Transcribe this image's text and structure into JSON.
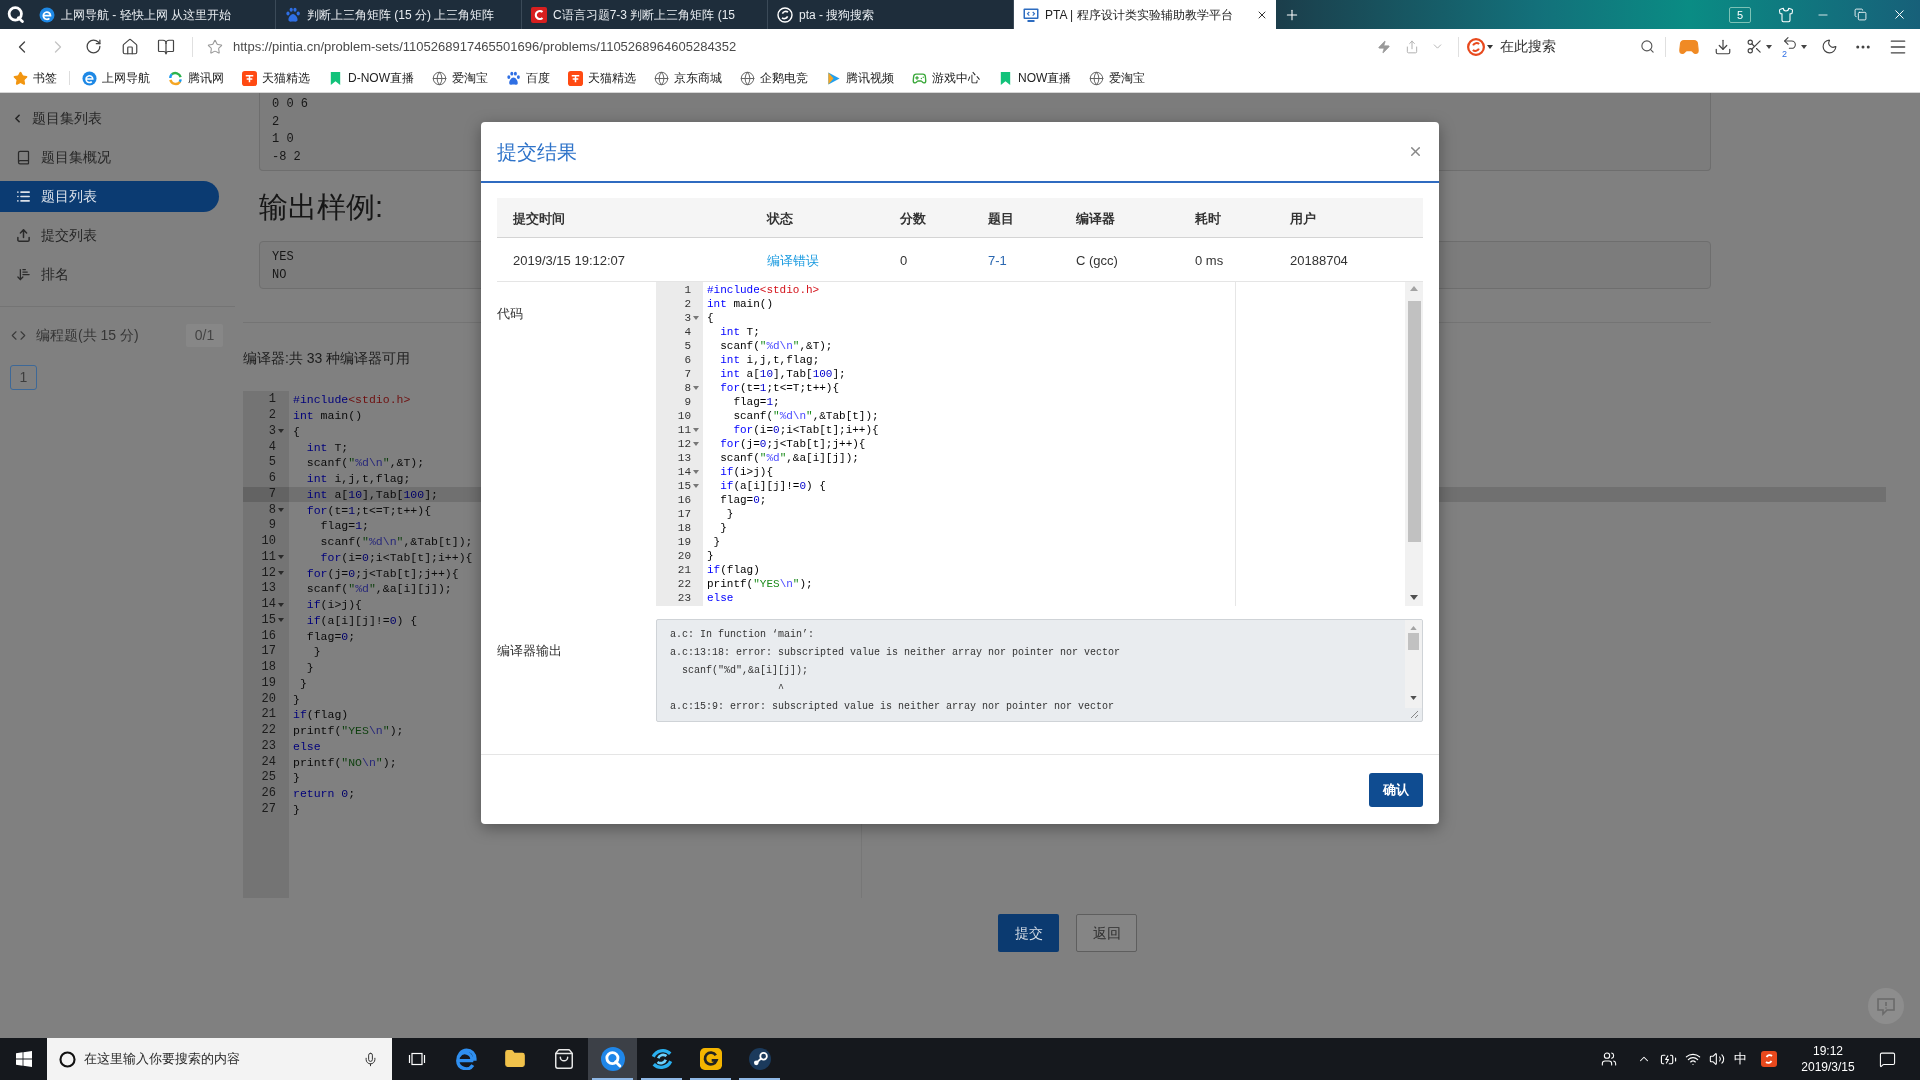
{
  "browser": {
    "tabs": [
      {
        "title": "上网导航 - 轻快上网 从这里开始",
        "kind": "e",
        "selected": false
      },
      {
        "title": "判断上三角矩阵 (15 分) 上三角矩阵",
        "kind": "paw",
        "selected": false
      },
      {
        "title": "C语言习题7-3 判断上三角矩阵 (15",
        "kind": "c",
        "selected": false
      },
      {
        "title": "pta - 搜狗搜索",
        "kind": "s",
        "selected": false
      },
      {
        "title": "PTA | 程序设计类实验辅助教学平台",
        "kind": "pta",
        "selected": true
      }
    ],
    "tab_count": "5",
    "back": {
      "disabled": false
    },
    "forward": {
      "disabled": true
    },
    "address": "https://pintia.cn/problem-sets/1105268917465501696/problems/1105268964605284352",
    "search": {
      "placeholder": "在此搜索"
    },
    "undo_count": "2",
    "bookmarks": [
      {
        "label": "书签",
        "kind": "star"
      },
      {
        "label": "上网导航",
        "kind": "e"
      },
      {
        "label": "腾讯网",
        "kind": "tencent"
      },
      {
        "label": "天猫精选",
        "kind": "tmall"
      },
      {
        "label": "D-NOW直播",
        "kind": "now"
      },
      {
        "label": "爱淘宝",
        "kind": "globe"
      },
      {
        "label": "百度",
        "kind": "paw"
      },
      {
        "label": "天猫精选",
        "kind": "tmall"
      },
      {
        "label": "京东商城",
        "kind": "globe"
      },
      {
        "label": "企鹅电竞",
        "kind": "globe"
      },
      {
        "label": "腾讯视频",
        "kind": "play"
      },
      {
        "label": "游戏中心",
        "kind": "gamepad"
      },
      {
        "label": "NOW直播",
        "kind": "now"
      },
      {
        "label": "爱淘宝",
        "kind": "globe"
      }
    ]
  },
  "sidebar": {
    "back": "题目集列表",
    "items": [
      {
        "label": "题目集概况",
        "kind": "book",
        "selected": false
      },
      {
        "label": "题目列表",
        "kind": "list",
        "selected": true
      },
      {
        "label": "提交列表",
        "kind": "upload",
        "selected": false
      },
      {
        "label": "排名",
        "kind": "rank",
        "selected": false
      }
    ],
    "section": {
      "title": "编程题(共 15 分)",
      "score": "0/1",
      "problems": [
        {
          "label": "1",
          "selected": true
        }
      ]
    }
  },
  "page": {
    "input_sample": [
      "0 0 6",
      "2",
      "1 0",
      "-8 2"
    ],
    "output_heading": "输出样例:",
    "output_sample": [
      "YES",
      "NO"
    ],
    "compiler_note": "编译器:共 33 种编译器可用",
    "editor": {
      "lines": [
        {
          "no": "1",
          "fold": false,
          "highlighted": false,
          "code": [
            {
              "kind": "keyword",
              "text": "#include"
            },
            {
              "kind": "header",
              "text": "<stdio.h>"
            }
          ]
        },
        {
          "no": "2",
          "fold": false,
          "highlighted": false,
          "code": [
            {
              "kind": "keyword",
              "text": "int"
            },
            {
              "kind": "text",
              "text": " main()"
            }
          ]
        },
        {
          "no": "3",
          "fold": true,
          "highlighted": false,
          "code": [
            {
              "kind": "text",
              "text": "{"
            }
          ]
        },
        {
          "no": "4",
          "fold": false,
          "highlighted": false,
          "code": [
            {
              "kind": "keyword",
              "text": "  int"
            },
            {
              "kind": "text",
              "text": " T;"
            }
          ]
        },
        {
          "no": "5",
          "fold": false,
          "highlighted": false,
          "code": [
            {
              "kind": "text",
              "text": "  scanf("
            },
            {
              "kind": "string",
              "text": "\""
            },
            {
              "kind": "escape",
              "text": "%d\\n"
            },
            {
              "kind": "string",
              "text": "\""
            },
            {
              "kind": "text",
              "text": ",&T);"
            }
          ]
        },
        {
          "no": "6",
          "fold": false,
          "highlighted": false,
          "code": [
            {
              "kind": "keyword",
              "text": "  int"
            },
            {
              "kind": "text",
              "text": " i,j,t,flag;"
            }
          ]
        },
        {
          "no": "7",
          "fold": false,
          "highlighted": true,
          "code": [
            {
              "kind": "keyword",
              "text": "  int"
            },
            {
              "kind": "text",
              "text": " a["
            },
            {
              "kind": "number",
              "text": "10"
            },
            {
              "kind": "text",
              "text": "],Tab["
            },
            {
              "kind": "number",
              "text": "100"
            },
            {
              "kind": "text",
              "text": "];"
            }
          ]
        },
        {
          "no": "8",
          "fold": true,
          "highlighted": false,
          "code": [
            {
              "kind": "keyword",
              "text": "  for"
            },
            {
              "kind": "text",
              "text": "(t="
            },
            {
              "kind": "number",
              "text": "1"
            },
            {
              "kind": "text",
              "text": ";t<=T;t++){"
            }
          ]
        },
        {
          "no": "9",
          "fold": false,
          "highlighted": false,
          "code": [
            {
              "kind": "text",
              "text": "    flag="
            },
            {
              "kind": "number",
              "text": "1"
            },
            {
              "kind": "text",
              "text": ";"
            }
          ]
        },
        {
          "no": "10",
          "fold": false,
          "highlighted": false,
          "code": [
            {
              "kind": "text",
              "text": "    scanf("
            },
            {
              "kind": "string",
              "text": "\""
            },
            {
              "kind": "escape",
              "text": "%d\\n"
            },
            {
              "kind": "string",
              "text": "\""
            },
            {
              "kind": "text",
              "text": ",&Tab[t]);"
            }
          ]
        },
        {
          "no": "11",
          "fold": true,
          "highlighted": false,
          "code": [
            {
              "kind": "keyword",
              "text": "    for"
            },
            {
              "kind": "text",
              "text": "(i="
            },
            {
              "kind": "number",
              "text": "0"
            },
            {
              "kind": "text",
              "text": ";i<Tab[t];i++){"
            }
          ]
        },
        {
          "no": "12",
          "fold": true,
          "highlighted": false,
          "code": [
            {
              "kind": "keyword",
              "text": "  for"
            },
            {
              "kind": "text",
              "text": "(j="
            },
            {
              "kind": "number",
              "text": "0"
            },
            {
              "kind": "text",
              "text": ";j<Tab[t];j++){"
            }
          ]
        },
        {
          "no": "13",
          "fold": false,
          "highlighted": false,
          "code": [
            {
              "kind": "text",
              "text": "  scanf("
            },
            {
              "kind": "string",
              "text": "\""
            },
            {
              "kind": "escape",
              "text": "%d"
            },
            {
              "kind": "string",
              "text": "\""
            },
            {
              "kind": "text",
              "text": ",&a[i][j]);"
            }
          ]
        },
        {
          "no": "14",
          "fold": true,
          "highlighted": false,
          "code": [
            {
              "kind": "keyword",
              "text": "  if"
            },
            {
              "kind": "text",
              "text": "(i>j){"
            }
          ]
        },
        {
          "no": "15",
          "fold": true,
          "highlighted": false,
          "code": [
            {
              "kind": "keyword",
              "text": "  if"
            },
            {
              "kind": "text",
              "text": "(a[i][j]!="
            },
            {
              "kind": "number",
              "text": "0"
            },
            {
              "kind": "text",
              "text": ") {"
            }
          ]
        },
        {
          "no": "16",
          "fold": false,
          "highlighted": false,
          "code": [
            {
              "kind": "text",
              "text": "  flag="
            },
            {
              "kind": "number",
              "text": "0"
            },
            {
              "kind": "text",
              "text": ";"
            }
          ]
        },
        {
          "no": "17",
          "fold": false,
          "highlighted": false,
          "code": [
            {
              "kind": "text",
              "text": "   }"
            }
          ]
        },
        {
          "no": "18",
          "fold": false,
          "highlighted": false,
          "code": [
            {
              "kind": "text",
              "text": "  }"
            }
          ]
        },
        {
          "no": "19",
          "fold": false,
          "highlighted": false,
          "code": [
            {
              "kind": "text",
              "text": " }"
            }
          ]
        },
        {
          "no": "20",
          "fold": false,
          "highlighted": false,
          "code": [
            {
              "kind": "text",
              "text": "}"
            }
          ]
        },
        {
          "no": "21",
          "fold": false,
          "highlighted": false,
          "code": [
            {
              "kind": "keyword",
              "text": "if"
            },
            {
              "kind": "text",
              "text": "(flag)"
            }
          ]
        },
        {
          "no": "22",
          "fold": false,
          "highlighted": false,
          "code": [
            {
              "kind": "text",
              "text": "printf("
            },
            {
              "kind": "string",
              "text": "\"YES"
            },
            {
              "kind": "escape",
              "text": "\\n"
            },
            {
              "kind": "string",
              "text": "\""
            },
            {
              "kind": "text",
              "text": ");"
            }
          ]
        },
        {
          "no": "23",
          "fold": false,
          "highlighted": false,
          "code": [
            {
              "kind": "keyword",
              "text": "else"
            }
          ]
        },
        {
          "no": "24",
          "fold": false,
          "highlighted": false,
          "code": [
            {
              "kind": "text",
              "text": "printf("
            },
            {
              "kind": "string",
              "text": "\"NO"
            },
            {
              "kind": "escape",
              "text": "\\n"
            },
            {
              "kind": "string",
              "text": "\""
            },
            {
              "kind": "text",
              "text": ");"
            }
          ]
        },
        {
          "no": "25",
          "fold": false,
          "highlighted": false,
          "code": [
            {
              "kind": "text",
              "text": "}"
            }
          ]
        },
        {
          "no": "26",
          "fold": false,
          "highlighted": false,
          "code": [
            {
              "kind": "keyword",
              "text": "return"
            },
            {
              "kind": "number",
              "text": " 0"
            },
            {
              "kind": "text",
              "text": ";"
            }
          ]
        },
        {
          "no": "27",
          "fold": false,
          "highlighted": false,
          "code": [
            {
              "kind": "text",
              "text": "}"
            }
          ]
        }
      ]
    },
    "buttons": [
      {
        "label": "提交",
        "kind": "primary"
      },
      {
        "label": "返回",
        "kind": "secondary"
      }
    ]
  },
  "dialog": {
    "title": "提交结果",
    "table": {
      "columns": [
        "提交时间",
        "状态",
        "分数",
        "题目",
        "编译器",
        "耗时",
        "用户"
      ],
      "rows": [
        {
          "cells": [
            {
              "text": "2019/3/15 19:12:07",
              "kind": "text"
            },
            {
              "text": "编译错误",
              "kind": "status"
            },
            {
              "text": "0",
              "kind": "text"
            },
            {
              "text": "7-1",
              "kind": "link"
            },
            {
              "text": "C (gcc)",
              "kind": "text"
            },
            {
              "text": "0 ms",
              "kind": "text"
            },
            {
              "text": "20188704",
              "kind": "text"
            }
          ]
        }
      ]
    },
    "code_label": "代码",
    "code": {
      "lines": [
        {
          "no": "1",
          "fold": false,
          "code": [
            {
              "kind": "keyword",
              "text": "#include"
            },
            {
              "kind": "header",
              "text": "<stdio.h>"
            }
          ]
        },
        {
          "no": "2",
          "fold": false,
          "code": [
            {
              "kind": "keyword",
              "text": "int"
            },
            {
              "kind": "text",
              "text": " main()"
            }
          ]
        },
        {
          "no": "3",
          "fold": true,
          "code": [
            {
              "kind": "text",
              "text": "{"
            }
          ]
        },
        {
          "no": "4",
          "fold": false,
          "code": [
            {
              "kind": "keyword",
              "text": "  int"
            },
            {
              "kind": "text",
              "text": " T;"
            }
          ]
        },
        {
          "no": "5",
          "fold": false,
          "code": [
            {
              "kind": "text",
              "text": "  scanf("
            },
            {
              "kind": "string",
              "text": "\""
            },
            {
              "kind": "escape",
              "text": "%d\\n"
            },
            {
              "kind": "string",
              "text": "\""
            },
            {
              "kind": "text",
              "text": ",&T);"
            }
          ]
        },
        {
          "no": "6",
          "fold": false,
          "code": [
            {
              "kind": "keyword",
              "text": "  int"
            },
            {
              "kind": "text",
              "text": " i,j,t,flag;"
            }
          ]
        },
        {
          "no": "7",
          "fold": false,
          "code": [
            {
              "kind": "keyword",
              "text": "  int"
            },
            {
              "kind": "text",
              "text": " a["
            },
            {
              "kind": "number",
              "text": "10"
            },
            {
              "kind": "text",
              "text": "],Tab["
            },
            {
              "kind": "number",
              "text": "100"
            },
            {
              "kind": "text",
              "text": "];"
            }
          ]
        },
        {
          "no": "8",
          "fold": true,
          "code": [
            {
              "kind": "keyword",
              "text": "  for"
            },
            {
              "kind": "text",
              "text": "(t="
            },
            {
              "kind": "number",
              "text": "1"
            },
            {
              "kind": "text",
              "text": ";t<=T;t++){"
            }
          ]
        },
        {
          "no": "9",
          "fold": false,
          "code": [
            {
              "kind": "text",
              "text": "    flag="
            },
            {
              "kind": "number",
              "text": "1"
            },
            {
              "kind": "text",
              "text": ";"
            }
          ]
        },
        {
          "no": "10",
          "fold": false,
          "code": [
            {
              "kind": "text",
              "text": "    scanf("
            },
            {
              "kind": "string",
              "text": "\""
            },
            {
              "kind": "escape",
              "text": "%d\\n"
            },
            {
              "kind": "string",
              "text": "\""
            },
            {
              "kind": "text",
              "text": ",&Tab[t]);"
            }
          ]
        },
        {
          "no": "11",
          "fold": true,
          "code": [
            {
              "kind": "keyword",
              "text": "    for"
            },
            {
              "kind": "text",
              "text": "(i="
            },
            {
              "kind": "number",
              "text": "0"
            },
            {
              "kind": "text",
              "text": ";i<Tab[t];i++){"
            }
          ]
        },
        {
          "no": "12",
          "fold": true,
          "code": [
            {
              "kind": "keyword",
              "text": "  for"
            },
            {
              "kind": "text",
              "text": "(j="
            },
            {
              "kind": "number",
              "text": "0"
            },
            {
              "kind": "text",
              "text": ";j<Tab[t];j++){"
            }
          ]
        },
        {
          "no": "13",
          "fold": false,
          "code": [
            {
              "kind": "text",
              "text": "  scanf("
            },
            {
              "kind": "string",
              "text": "\""
            },
            {
              "kind": "escape",
              "text": "%d"
            },
            {
              "kind": "string",
              "text": "\""
            },
            {
              "kind": "text",
              "text": ",&a[i][j]);"
            }
          ]
        },
        {
          "no": "14",
          "fold": true,
          "code": [
            {
              "kind": "keyword",
              "text": "  if"
            },
            {
              "kind": "text",
              "text": "(i>j){"
            }
          ]
        },
        {
          "no": "15",
          "fold": true,
          "code": [
            {
              "kind": "keyword",
              "text": "  if"
            },
            {
              "kind": "text",
              "text": "(a[i][j]!="
            },
            {
              "kind": "number",
              "text": "0"
            },
            {
              "kind": "text",
              "text": ") {"
            }
          ]
        },
        {
          "no": "16",
          "fold": false,
          "code": [
            {
              "kind": "text",
              "text": "  flag="
            },
            {
              "kind": "number",
              "text": "0"
            },
            {
              "kind": "text",
              "text": ";"
            }
          ]
        },
        {
          "no": "17",
          "fold": false,
          "code": [
            {
              "kind": "text",
              "text": "   }"
            }
          ]
        },
        {
          "no": "18",
          "fold": false,
          "code": [
            {
              "kind": "text",
              "text": "  }"
            }
          ]
        },
        {
          "no": "19",
          "fold": false,
          "code": [
            {
              "kind": "text",
              "text": " }"
            }
          ]
        },
        {
          "no": "20",
          "fold": false,
          "code": [
            {
              "kind": "text",
              "text": "}"
            }
          ]
        },
        {
          "no": "21",
          "fold": false,
          "code": [
            {
              "kind": "keyword",
              "text": "if"
            },
            {
              "kind": "text",
              "text": "(flag)"
            }
          ]
        },
        {
          "no": "22",
          "fold": false,
          "code": [
            {
              "kind": "text",
              "text": "printf("
            },
            {
              "kind": "string",
              "text": "\"YES"
            },
            {
              "kind": "escape",
              "text": "\\n"
            },
            {
              "kind": "string",
              "text": "\""
            },
            {
              "kind": "text",
              "text": ");"
            }
          ]
        },
        {
          "no": "23",
          "fold": false,
          "code": [
            {
              "kind": "keyword",
              "text": "else"
            }
          ]
        }
      ]
    },
    "output_label": "编译器输出",
    "output": [
      "a.c: In function ‘main’:",
      "a.c:13:18: error: subscripted value is neither array nor pointer nor vector",
      "  scanf(\"%d\",&a[i][j]);",
      "                  ^",
      "a.c:15:9: error: subscripted value is neither array nor pointer nor vector"
    ],
    "confirm": "确认"
  },
  "taskbar": {
    "search": {
      "placeholder": "在这里输入你要搜索的内容"
    },
    "apps": [
      {
        "kind": "taskview",
        "running": false,
        "selected": false
      },
      {
        "kind": "edge",
        "running": false,
        "selected": false
      },
      {
        "kind": "explorer",
        "running": false,
        "selected": false
      },
      {
        "kind": "store",
        "running": false,
        "selected": false
      },
      {
        "kind": "qbrowser",
        "running": true,
        "selected": true
      },
      {
        "kind": "sogou",
        "running": true,
        "selected": false
      },
      {
        "kind": "g",
        "running": true,
        "selected": false
      },
      {
        "kind": "steam",
        "running": true,
        "selected": false
      }
    ],
    "ime": "中",
    "time": "19:12",
    "date": "2019/3/15"
  }
}
